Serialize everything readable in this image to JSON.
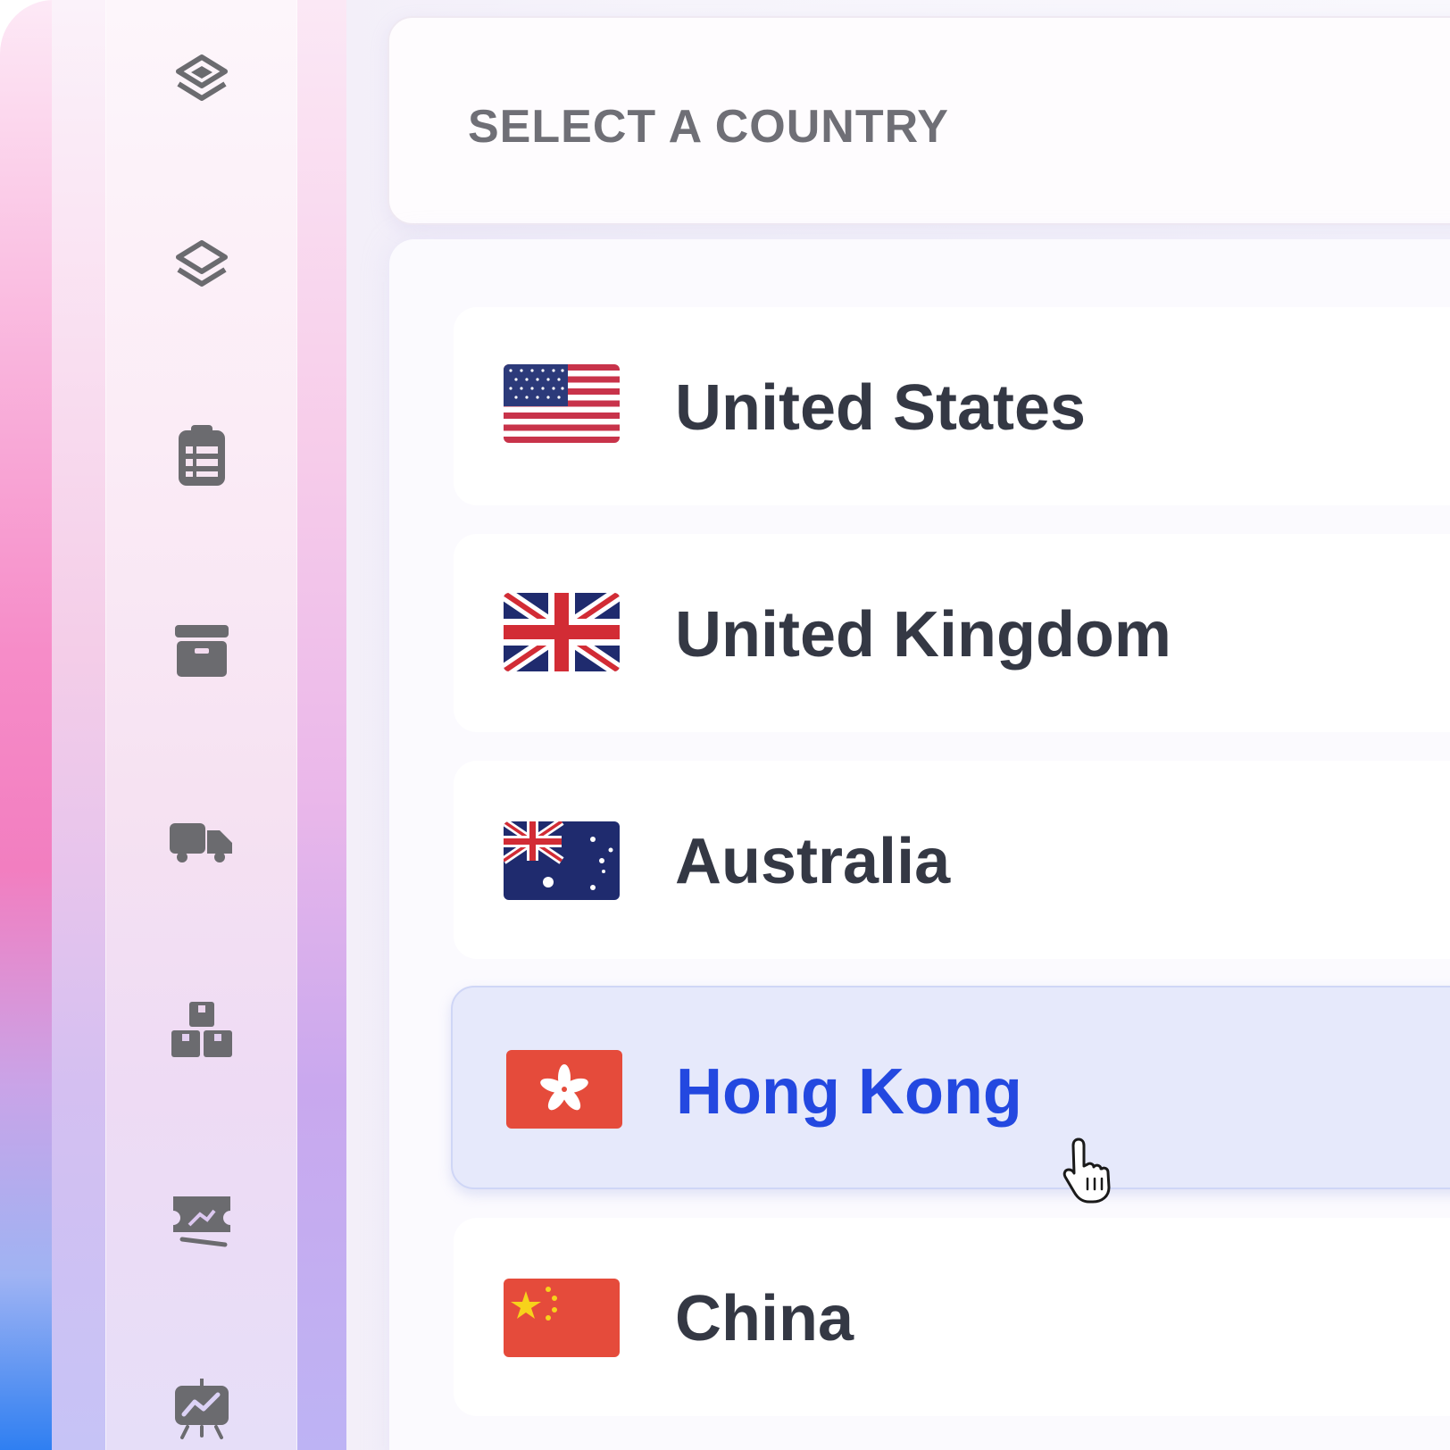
{
  "sidebar": {
    "icons": [
      {
        "name": "layers-diamond-icon"
      },
      {
        "name": "layers-icon"
      },
      {
        "name": "calendar-clipboard-icon"
      },
      {
        "name": "archive-box-icon"
      },
      {
        "name": "delivery-truck-icon"
      },
      {
        "name": "stacked-boxes-icon"
      },
      {
        "name": "ticket-icon"
      },
      {
        "name": "presentation-chart-icon"
      }
    ]
  },
  "select": {
    "label": "SELECT A COUNTRY"
  },
  "countries": [
    {
      "name": "United States",
      "flag": "us-flag-icon",
      "selected": false
    },
    {
      "name": "United Kingdom",
      "flag": "uk-flag-icon",
      "selected": false
    },
    {
      "name": "Australia",
      "flag": "australia-flag-icon",
      "selected": false
    },
    {
      "name": "Hong Kong",
      "flag": "hong-kong-flag-icon",
      "selected": true
    },
    {
      "name": "China",
      "flag": "china-flag-icon",
      "selected": false
    }
  ],
  "colors": {
    "selected_text": "#2348e0",
    "selected_bg": "#e6e9fb",
    "item_text": "#343844",
    "icon_gray": "#6b6b6f"
  }
}
